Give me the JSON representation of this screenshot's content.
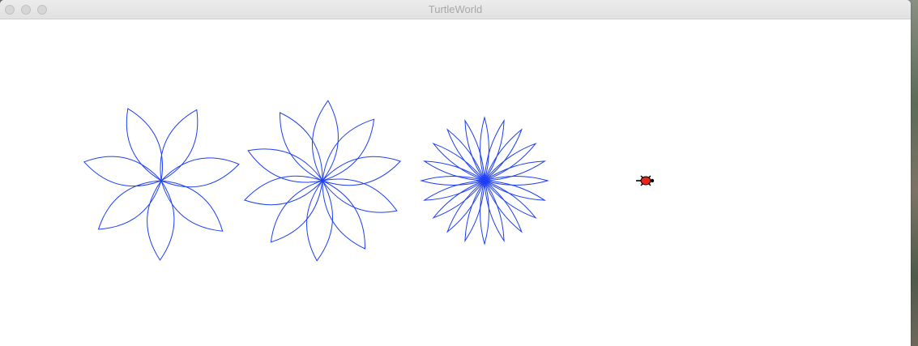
{
  "window": {
    "title": "TurtleWorld"
  },
  "titlebar": {
    "buttons": [
      "close",
      "minimize",
      "zoom"
    ]
  },
  "canvas": {
    "stroke_color": "#1f3ff5",
    "flowers": [
      {
        "name": "flower-1",
        "petals": 7
      },
      {
        "name": "flower-2",
        "petals": 10
      },
      {
        "name": "flower-3",
        "petals": 20
      }
    ],
    "turtle": {
      "body_color": "#e8261c",
      "heading": "east"
    }
  }
}
